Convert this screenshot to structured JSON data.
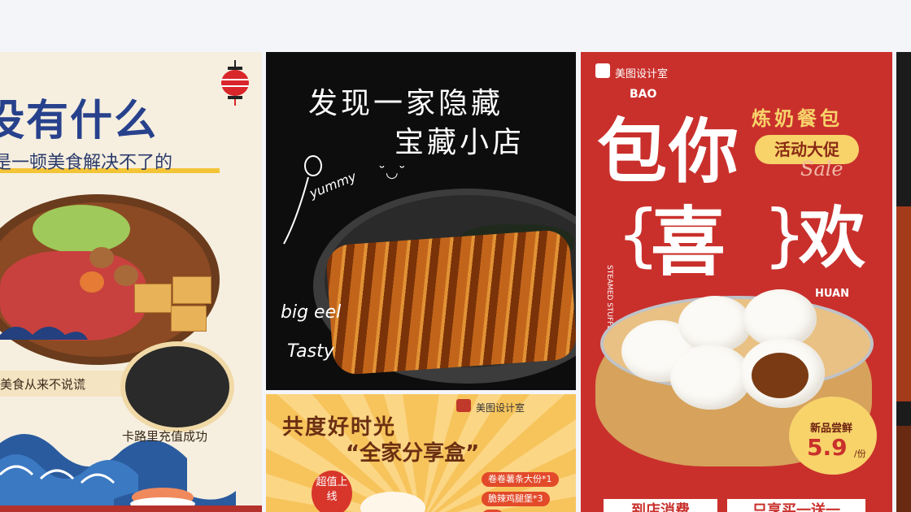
{
  "cards": {
    "hotpot": {
      "title": "没有什么",
      "subtitle": "是一顿美食解决不了的",
      "note1": "美食从来不说谎",
      "note2": "卡路里充值成功"
    },
    "eel": {
      "line1": "发现一家隐藏",
      "line2": "宝藏小店",
      "yummy": "yummy",
      "smile": "˘◡˘",
      "big_eel": "big eel",
      "tasty": "Tasty"
    },
    "family": {
      "brand": "美图设计室",
      "line1": "共度好时光",
      "line2": "“全家分享盒”",
      "badge": "超值上线",
      "items": [
        "卷卷薯条大份*1",
        "脆辣鸡腿堡*3",
        "..."
      ]
    },
    "bao": {
      "brand": "美图设计室",
      "bao_label": "BAO",
      "char1": "包你",
      "char2": "喜",
      "char3": "欢",
      "bracket_left": "{",
      "bracket_right": "}",
      "side_title": "炼奶餐包",
      "promo": "活动大促",
      "sale": "Sale",
      "huan_label": "HUAN",
      "steamed": "STEAMED STUFFED BUN",
      "price_label": "新品尝鲜",
      "price_value": "5.9",
      "price_unit": "/份",
      "bottom_left": "到店消费",
      "bottom_right": "只享买一送一"
    }
  },
  "colors": {
    "page_bg": "#f3f5f8",
    "bao_red": "#c9302c",
    "accent_yellow": "#f7d36a",
    "navy_title": "#27418c"
  }
}
